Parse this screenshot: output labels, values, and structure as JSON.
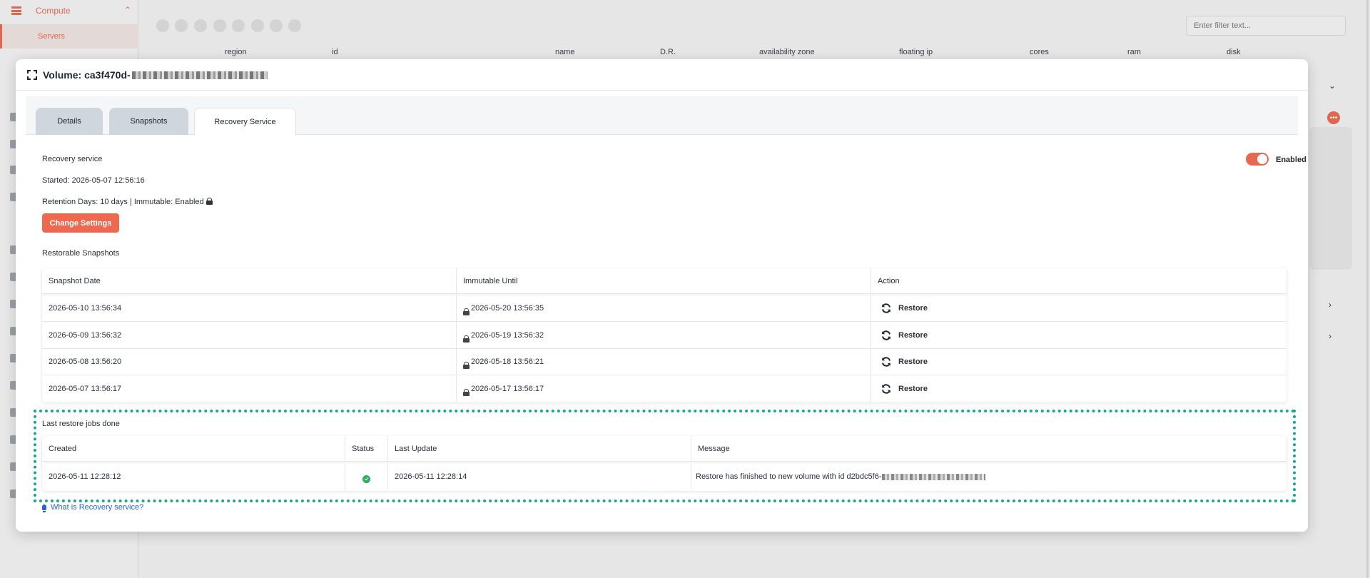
{
  "sidebar": {
    "section_label": "Compute",
    "active_item": "Servers"
  },
  "toolbar": {
    "filter_placeholder": "Enter filter text..."
  },
  "server_table": {
    "columns": [
      "region",
      "id",
      "name",
      "D.R.",
      "availability zone",
      "floating ip",
      "cores",
      "ram",
      "disk"
    ]
  },
  "modal": {
    "title_prefix": "Volume: ca3f470d-",
    "tabs": [
      {
        "label": "Details",
        "active": false
      },
      {
        "label": "Snapshots",
        "active": false
      },
      {
        "label": "Recovery Service",
        "active": true
      }
    ],
    "recovery": {
      "section_label": "Recovery service",
      "toggle_label": "Enabled",
      "toggle_on": true,
      "started": "Started: 2026-05-07 12:56:16",
      "retention": "Retention Days: 10 days | Immutable: Enabled",
      "change_settings_label": "Change Settings"
    },
    "snapshots": {
      "title": "Restorable Snapshots",
      "headers": [
        "Snapshot Date",
        "Immutable Until",
        "Action"
      ],
      "rows": [
        {
          "date": "2026-05-10 13:56:34",
          "immutable_until": "2026-05-20 13:56:35",
          "action": "Restore"
        },
        {
          "date": "2026-05-09 13:56:32",
          "immutable_until": "2026-05-19 13:56:32",
          "action": "Restore"
        },
        {
          "date": "2026-05-08 13:56:20",
          "immutable_until": "2026-05-18 13:56:21",
          "action": "Restore"
        },
        {
          "date": "2026-05-07 13:56:17",
          "immutable_until": "2026-05-17 13:56:17",
          "action": "Restore"
        }
      ]
    },
    "restore_jobs": {
      "title": "Last restore jobs done",
      "headers": [
        "Created",
        "Status",
        "Last Update",
        "Message"
      ],
      "rows": [
        {
          "created": "2026-05-11 12:28:12",
          "status": "success",
          "last_update": "2026-05-11 12:28:14",
          "message": "Restore has finished to new volume with id d2bdc5f6-"
        }
      ]
    },
    "help_link": "What is Recovery service?"
  },
  "colors": {
    "accent": "#ee6a4f",
    "highlight": "#16a88a",
    "link": "#2a62d4",
    "success": "#27ae60"
  }
}
